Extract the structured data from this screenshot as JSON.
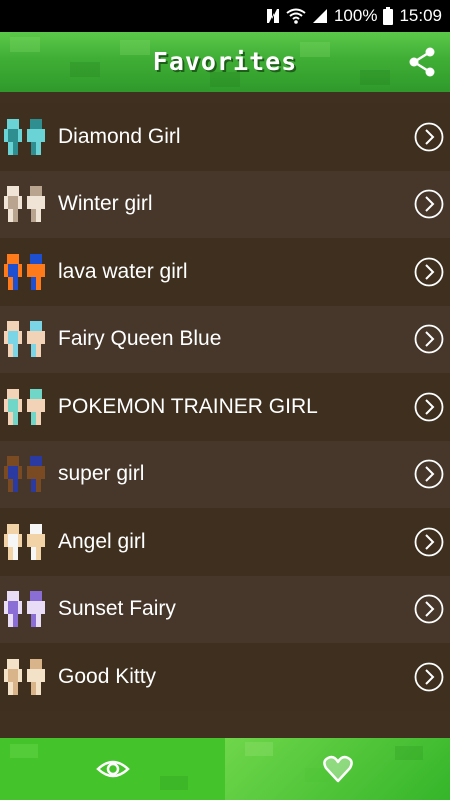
{
  "status_bar": {
    "icons": [
      "nfc-icon",
      "wifi-icon",
      "signal-icon"
    ],
    "battery": "100%",
    "time": "15:09"
  },
  "header": {
    "title": "Favorites",
    "share_icon": "share-icon"
  },
  "favorites": [
    {
      "name": "Diamond Girl",
      "skin_colors": [
        "#6ad3d6",
        "#2f8f90"
      ]
    },
    {
      "name": "Winter girl",
      "skin_colors": [
        "#efe4d6",
        "#b9a48f"
      ]
    },
    {
      "name": "lava water girl",
      "skin_colors": [
        "#ff7a1a",
        "#1e4fd0"
      ]
    },
    {
      "name": "Fairy Queen Blue",
      "skin_colors": [
        "#f2d3b8",
        "#7ad5e6"
      ]
    },
    {
      "name": "POKEMON TRAINER GIRL",
      "skin_colors": [
        "#f2d3b8",
        "#6fd6c8"
      ]
    },
    {
      "name": "super girl",
      "skin_colors": [
        "#7a4a22",
        "#2a3aa0"
      ]
    },
    {
      "name": "Angel girl",
      "skin_colors": [
        "#f2d3a8",
        "#f6f6f6"
      ]
    },
    {
      "name": "Sunset Fairy",
      "skin_colors": [
        "#e8dcf6",
        "#8a6ed6"
      ]
    },
    {
      "name": "Good Kitty",
      "skin_colors": [
        "#f4e2c8",
        "#d9b48a"
      ]
    }
  ],
  "bottom_nav": {
    "tabs": [
      {
        "icon": "eye-icon",
        "active": false
      },
      {
        "icon": "heart-icon",
        "active": true
      }
    ]
  },
  "colors": {
    "accent_green": "#3fae35",
    "list_row_dark": "#3e2f1f",
    "list_row_light": "#47372a"
  }
}
